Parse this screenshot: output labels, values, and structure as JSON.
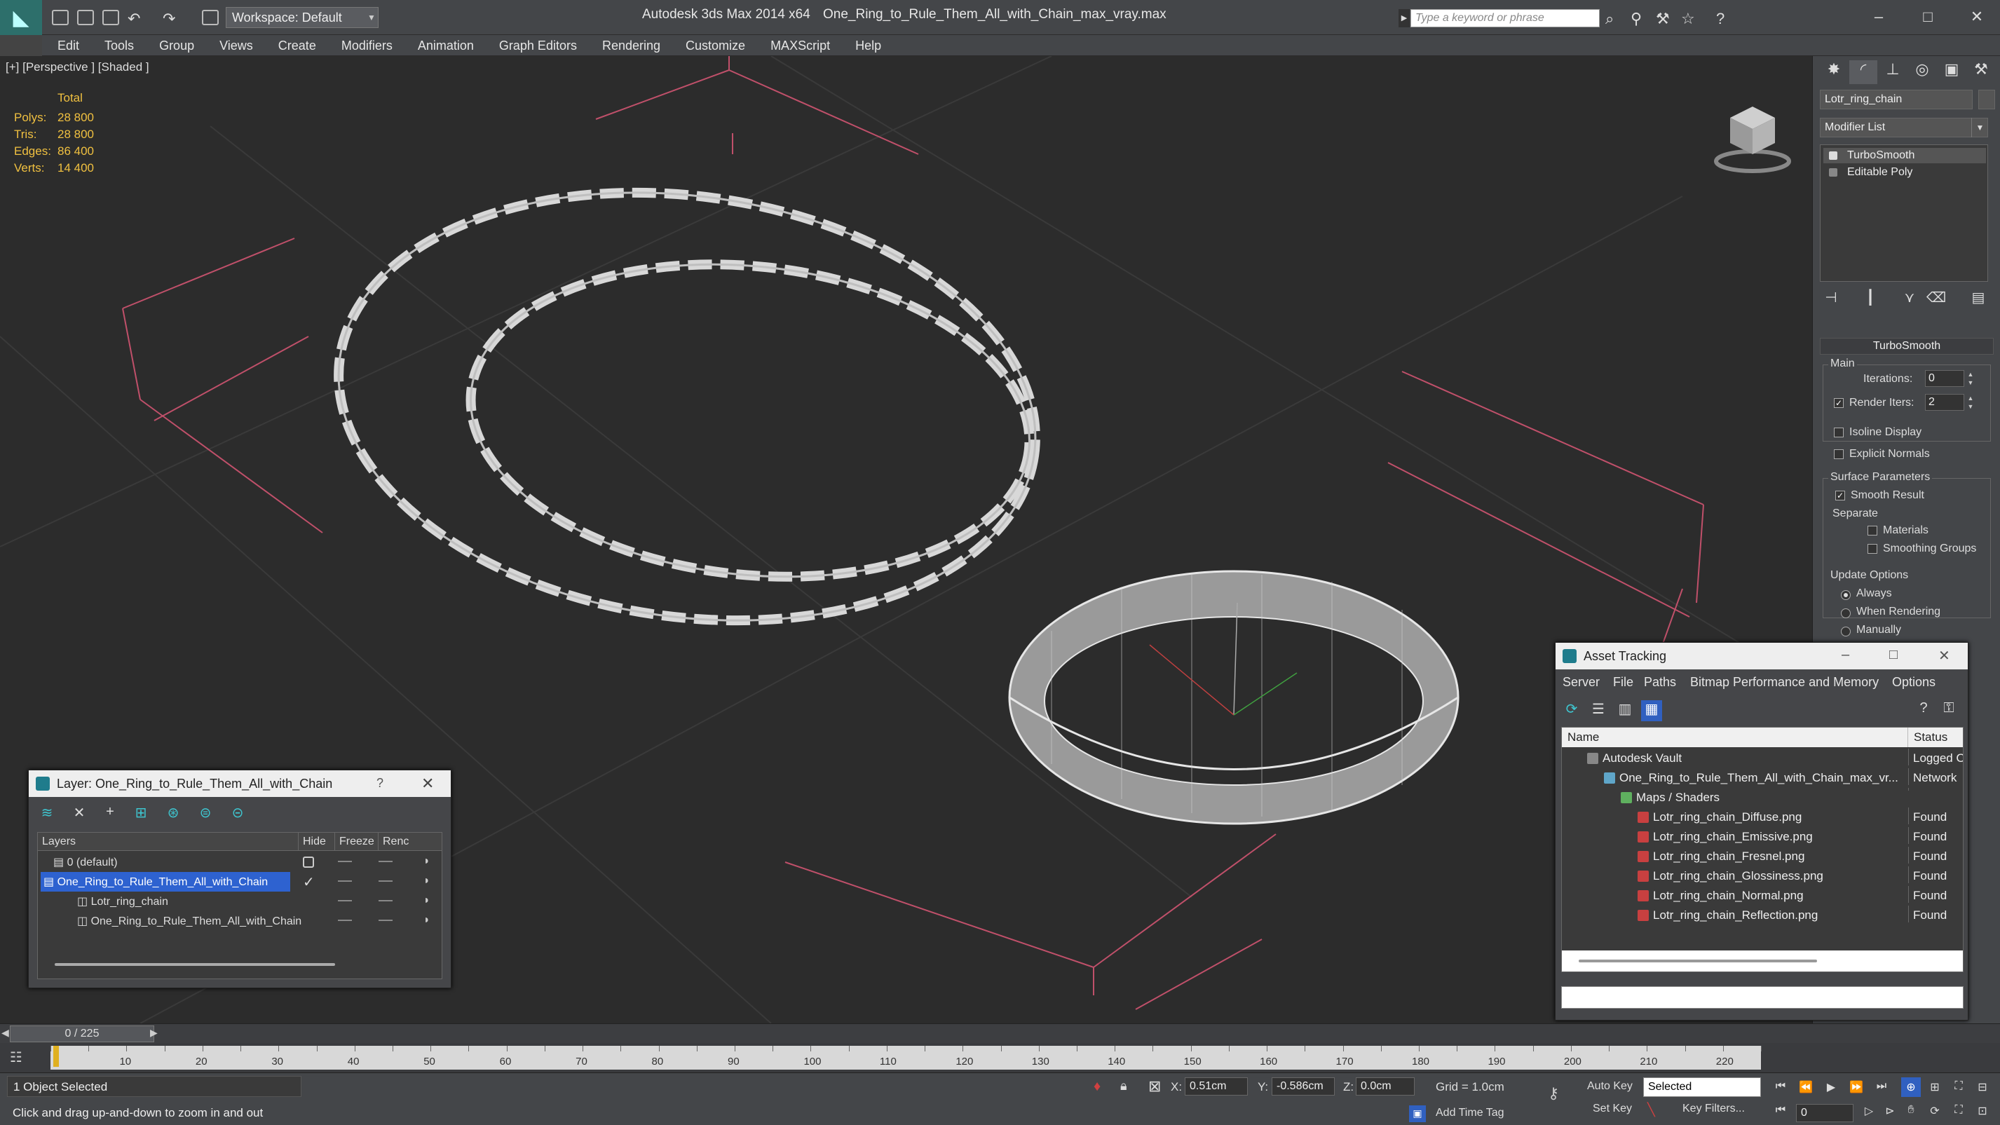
{
  "titlebar": {
    "workspace_label": "Workspace: Default",
    "app_title": "Autodesk 3ds Max  2014 x64",
    "file_title": "One_Ring_to_Rule_Them_All_with_Chain_max_vray.max",
    "search_placeholder": "Type a keyword or phrase"
  },
  "menu": [
    "Edit",
    "Tools",
    "Group",
    "Views",
    "Create",
    "Modifiers",
    "Animation",
    "Graph Editors",
    "Rendering",
    "Customize",
    "MAXScript",
    "Help"
  ],
  "viewport": {
    "label": "[+] [Perspective ] [Shaded ]",
    "stats_total": "Total",
    "stats": [
      {
        "label": "Polys:",
        "value": "28 800"
      },
      {
        "label": "Tris:",
        "value": "28 800"
      },
      {
        "label": "Edges:",
        "value": "86 400"
      },
      {
        "label": "Verts:",
        "value": "14 400"
      }
    ]
  },
  "command_panel": {
    "object_name": "Lotr_ring_chain",
    "modifier_list": "Modifier List",
    "stack": [
      "TurboSmooth",
      "Editable Poly"
    ],
    "rollout_title": "TurboSmooth",
    "main_label": "Main",
    "iterations_label": "Iterations:",
    "iterations_value": "0",
    "render_iters_label": "Render Iters:",
    "render_iters_value": "2",
    "isoline_label": "Isoline Display",
    "explicit_normals_label": "Explicit Normals",
    "surface_params_label": "Surface Parameters",
    "smooth_result_label": "Smooth Result",
    "separate_label": "Separate",
    "materials_label": "Materials",
    "smoothing_groups_label": "Smoothing Groups",
    "update_options_label": "Update Options",
    "always_label": "Always",
    "when_rendering_label": "When Rendering",
    "manually_label": "Manually"
  },
  "layer_window": {
    "title": "Layer: One_Ring_to_Rule_Them_All_with_Chain",
    "help": "?",
    "columns": [
      "Layers",
      "Hide",
      "Freeze",
      "Renc"
    ],
    "rows": [
      {
        "name": "0 (default)"
      },
      {
        "name": "One_Ring_to_Rule_Them_All_with_Chain"
      },
      {
        "name": "Lotr_ring_chain"
      },
      {
        "name": "One_Ring_to_Rule_Them_All_with_Chain"
      }
    ]
  },
  "asset_window": {
    "title": "Asset Tracking",
    "menu": [
      "Server",
      "File",
      "Paths",
      "Bitmap Performance and Memory",
      "Options"
    ],
    "columns": [
      "Name",
      "Status"
    ],
    "rows": [
      {
        "name": "Autodesk Vault",
        "status": "Logged O"
      },
      {
        "name": "One_Ring_to_Rule_Them_All_with_Chain_max_vr...",
        "status": "Network"
      },
      {
        "name": "Maps / Shaders",
        "status": ""
      },
      {
        "name": "Lotr_ring_chain_Diffuse.png",
        "status": "Found"
      },
      {
        "name": "Lotr_ring_chain_Emissive.png",
        "status": "Found"
      },
      {
        "name": "Lotr_ring_chain_Fresnel.png",
        "status": "Found"
      },
      {
        "name": "Lotr_ring_chain_Glossiness.png",
        "status": "Found"
      },
      {
        "name": "Lotr_ring_chain_Normal.png",
        "status": "Found"
      },
      {
        "name": "Lotr_ring_chain_Reflection.png",
        "status": "Found"
      }
    ]
  },
  "timeline": {
    "frame_label": "0 / 225",
    "ticks": [
      "10",
      "20",
      "30",
      "40",
      "50",
      "60",
      "70",
      "80",
      "90",
      "100",
      "110",
      "120",
      "130",
      "140",
      "150",
      "160",
      "170",
      "180",
      "190",
      "200",
      "210",
      "220"
    ]
  },
  "statusbar": {
    "selection": "1 Object Selected",
    "prompt": "Click and drag up-and-down to zoom in and out",
    "x_label": "X:",
    "x_value": "0.51cm",
    "y_label": "Y:",
    "y_value": "-0.586cm",
    "z_label": "Z:",
    "z_value": "0.0cm",
    "grid": "Grid = 1.0cm",
    "auto_key": "Auto Key",
    "set_key": "Set Key",
    "selected_option": "Selected",
    "key_filters": "Key Filters...",
    "add_time_tag": "Add Time Tag",
    "frame_value": "0"
  },
  "colors": {
    "layer_selected": "#2e62d0",
    "stats_text": "#f0c040",
    "accent": "#3ec6d0"
  }
}
